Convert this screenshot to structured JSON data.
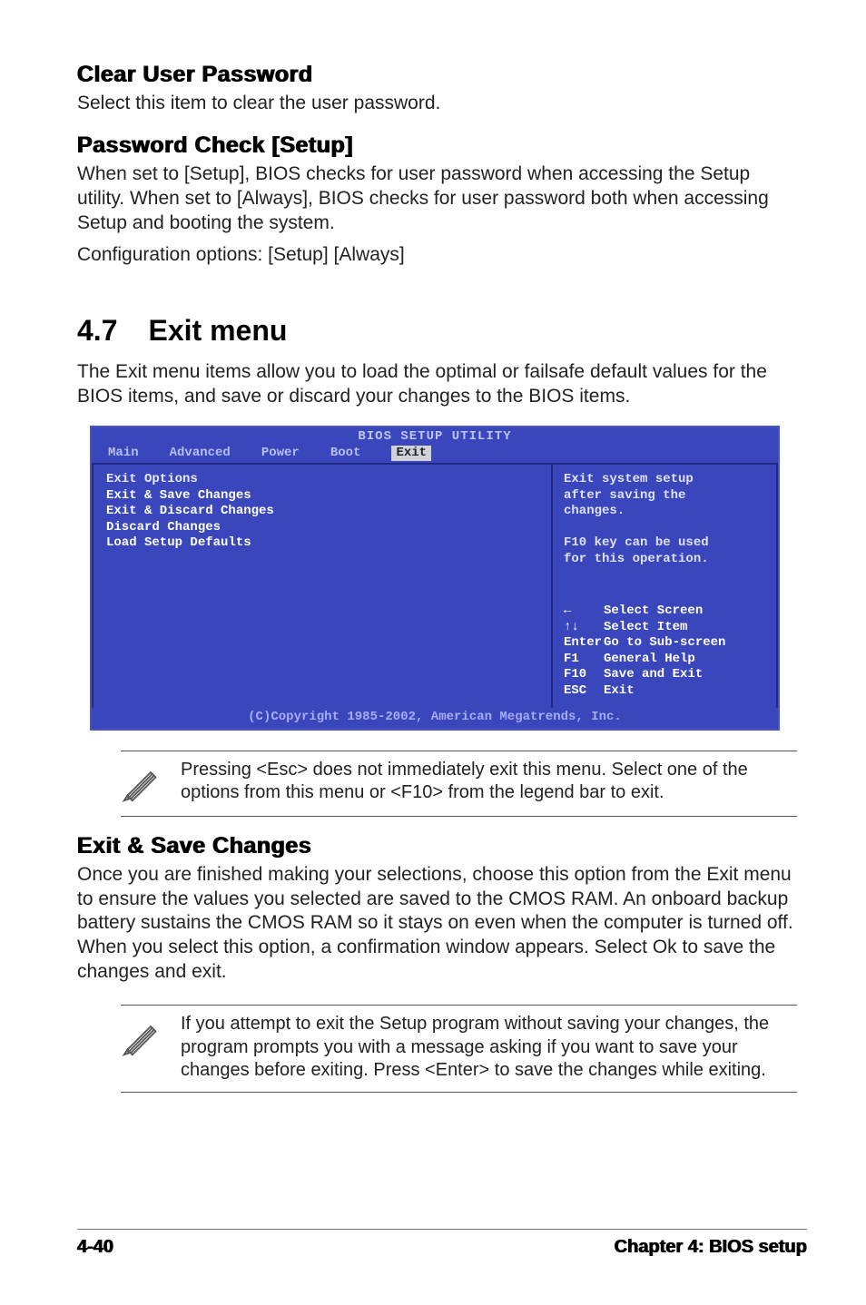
{
  "sections": {
    "clear_user_password": {
      "heading": "Clear User Password",
      "body": "Select this item to clear the user password."
    },
    "password_check": {
      "heading": "Password Check [Setup]",
      "body1": "When set to [Setup], BIOS checks for user password when accessing the Setup utility. When set to [Always], BIOS checks for user password both when accessing Setup and booting the system.",
      "body2": "Configuration options: [Setup] [Always]"
    },
    "exit_menu": {
      "number": "4.7",
      "title": "Exit menu",
      "intro": "The Exit menu items allow you to load the optimal or failsafe default values for the BIOS items, and save or discard your changes to the BIOS items."
    },
    "exit_save_changes": {
      "heading": "Exit & Save Changes",
      "body": "Once you are finished making your selections, choose this option from the Exit menu to ensure the values you selected are saved to the CMOS RAM. An onboard backup battery sustains the CMOS RAM so it stays on even when the computer is turned off. When you select this option, a confirmation window appears. Select Ok to save the changes and exit.",
      "body_bold": "Ok"
    }
  },
  "bios": {
    "title": "BIOS SETUP UTILITY",
    "tabs": [
      "Main",
      "Advanced",
      "Power",
      "Boot",
      "Exit"
    ],
    "active_tab": "Exit",
    "left": {
      "header": "Exit Options",
      "items": [
        "Exit & Save Changes",
        "Exit & Discard Changes",
        "Discard Changes",
        "",
        "Load Setup Defaults"
      ]
    },
    "right": {
      "help": [
        "Exit system setup",
        "after saving the",
        "changes.",
        "",
        "F10 key can be used",
        "for this operation."
      ],
      "keys": [
        {
          "k": "←",
          "d": "Select Screen"
        },
        {
          "k": "↑↓",
          "d": "Select Item"
        },
        {
          "k": "Enter",
          "d": "Go to Sub-screen"
        },
        {
          "k": "F1",
          "d": "General Help"
        },
        {
          "k": "F10",
          "d": "Save and Exit"
        },
        {
          "k": "ESC",
          "d": "Exit"
        }
      ]
    },
    "footer": "(C)Copyright 1985-2002, American Megatrends, Inc."
  },
  "notes": {
    "note1": "Pressing <Esc> does not immediately exit this menu. Select one of the options from this menu or <F10> from the legend bar to exit.",
    "note2": " If you attempt to exit the Setup program without saving your changes, the program prompts you with a message asking if you want to save your changes before exiting. Press <Enter>  to save the  changes while exiting."
  },
  "footer": {
    "left": "4-40",
    "right": "Chapter 4: BIOS setup"
  }
}
